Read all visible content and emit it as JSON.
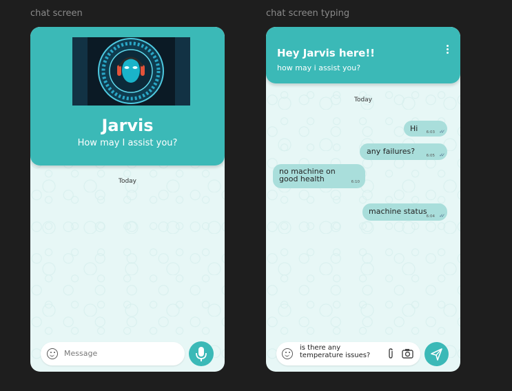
{
  "frames": [
    {
      "label": "chat screen",
      "bot_name": "Jarvis",
      "bot_subtitle": "How may I assist you?",
      "date_divider": "Today",
      "input_placeholder": "Message",
      "action_icon": "microphone-icon"
    },
    {
      "label": "chat screen typing",
      "header_title": "Hey Jarvis here!!",
      "header_subtitle": "how may i assist you?",
      "date_divider": "Today",
      "messages": [
        {
          "text": "Hi",
          "time": "6:03",
          "direction": "out",
          "read": true
        },
        {
          "text": "any failures?",
          "time": "6:05",
          "direction": "out",
          "read": true
        },
        {
          "text": "no machine on good health",
          "time": "6:10",
          "direction": "in",
          "read": false
        },
        {
          "text": "machine status",
          "time": "6:04",
          "direction": "out",
          "read": true
        }
      ],
      "input_value": "is there any temperature issues?",
      "action_icon": "send-icon"
    }
  ],
  "colors": {
    "accent": "#3bb9b7",
    "bubble": "#a9dedb",
    "chat_bg": "#e7f7f6",
    "canvas": "#1e1e1e"
  }
}
